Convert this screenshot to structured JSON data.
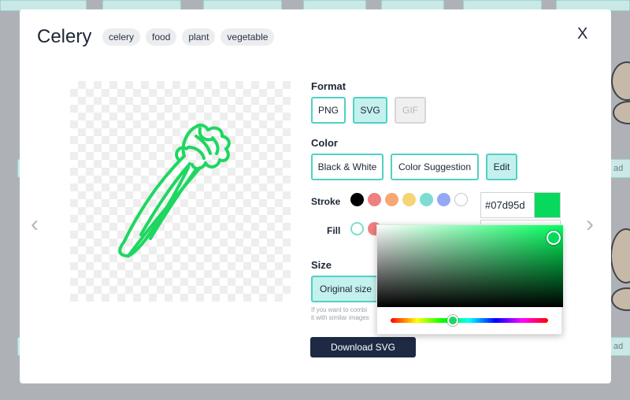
{
  "background": {
    "download_label": "ad"
  },
  "modal": {
    "title": "Celery",
    "tags": [
      "celery",
      "food",
      "plant",
      "vegetable"
    ],
    "close_glyph": "X",
    "prev_glyph": "‹",
    "next_glyph": "›",
    "preview_icon": "celery-icon"
  },
  "format": {
    "label": "Format",
    "options": [
      {
        "label": "PNG",
        "state": "normal"
      },
      {
        "label": "SVG",
        "state": "active"
      },
      {
        "label": "GIF",
        "state": "disabled"
      }
    ]
  },
  "color": {
    "label": "Color",
    "options": [
      {
        "label": "Black & White",
        "state": "normal"
      },
      {
        "label": "Color Suggestion",
        "state": "normal"
      },
      {
        "label": "Edit",
        "state": "active"
      }
    ],
    "stroke_label": "Stroke",
    "fill_label": "Fill",
    "stroke_swatches": [
      "#000000",
      "#f07f80",
      "#f6a874",
      "#f6d474",
      "#7edcd2",
      "#94a8f3",
      "#ffffff"
    ],
    "fill_swatches": [
      "#ffffff",
      "#f07f80"
    ],
    "hex_value": "#07d95d",
    "current_color": "#07d95d"
  },
  "size": {
    "label": "Size",
    "original_label": "Original size",
    "help_line1": "If you want to combi",
    "help_line2": "it with similar images"
  },
  "download_label": "Download SVG",
  "colors": {
    "accent": "#4fd1c5",
    "accent_fill": "#c4f1ee",
    "dark_button": "#1e2a44",
    "icon_green": "#1ed760"
  }
}
